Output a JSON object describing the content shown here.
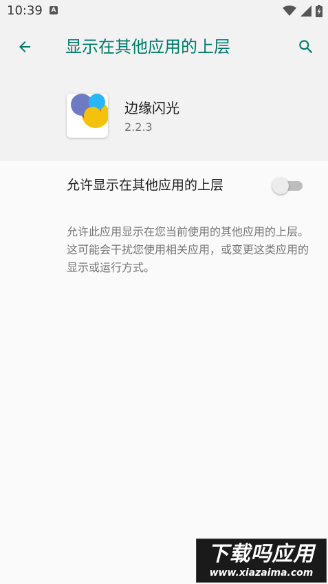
{
  "status_bar": {
    "time": "10:39",
    "a_icon_label": "A",
    "icons": [
      "wifi-icon",
      "signal-icon",
      "battery-charging-icon"
    ]
  },
  "app_bar": {
    "title": "显示在其他应用的上层",
    "back_icon": "arrow-left-icon",
    "search_icon": "search-icon",
    "accent_color": "#00796b"
  },
  "app": {
    "name": "边缘闪光",
    "version": "2.2.3",
    "icon": "app-icon"
  },
  "permission": {
    "label": "允许显示在其他应用的上层",
    "toggle_on": false
  },
  "description": "允许此应用显示在您当前使用的其他应用的上层。这可能会干扰您使用相关应用，或变更这类应用的显示或运行方式。",
  "watermark": {
    "title": "下载吗应用",
    "url": "www.xiazaima.com"
  }
}
